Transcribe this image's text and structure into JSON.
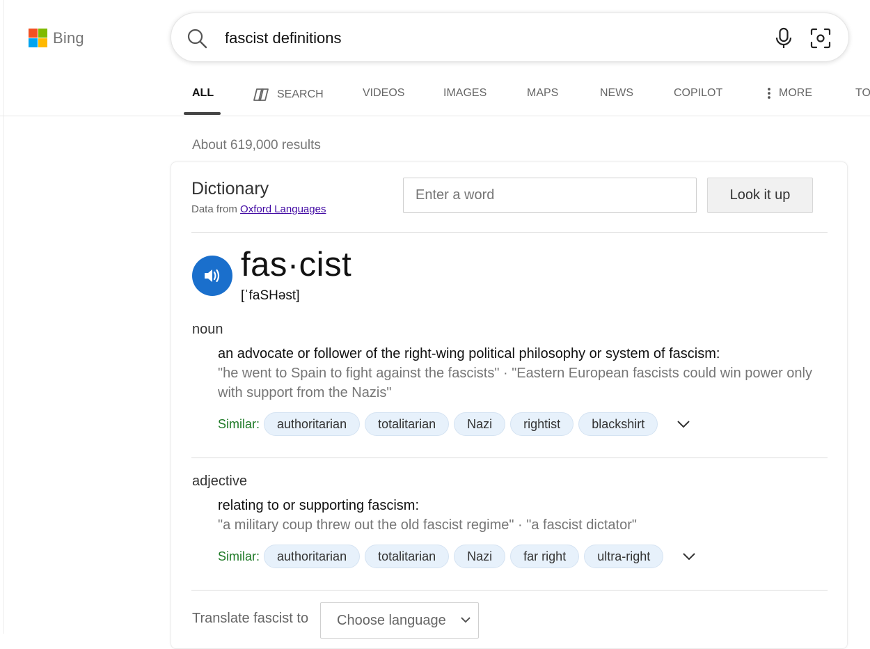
{
  "header": {
    "brand": "Bing",
    "brand_colors": [
      "#f25022",
      "#7fba00",
      "#00a4ef",
      "#ffb900"
    ],
    "search_query": "fascist definitions",
    "icons": [
      "search-icon",
      "microphone-icon",
      "visual-search-icon"
    ]
  },
  "tabs": {
    "all": "ALL",
    "search": "SEARCH",
    "videos": "VIDEOS",
    "images": "IMAGES",
    "maps": "MAPS",
    "news": "NEWS",
    "copilot": "COPILOT",
    "more": "MORE",
    "tools": "TO"
  },
  "results": {
    "count": "About 619,000 results"
  },
  "dictionary": {
    "title": "Dictionary",
    "source_prefix": "Data from",
    "source_link": "Oxford Languages",
    "input_placeholder": "Enter a word",
    "lookup_button": "Look it up",
    "headword": "fas·cist",
    "pronunciation": "[ˈfaSHəst]",
    "accent_color": "#1a6fcc",
    "senses": [
      {
        "pos": "noun",
        "definition": "an advocate or follower of the right-wing political philosophy or system of fascism:",
        "example": "\"he went to Spain to fight against the fascists\" · \"Eastern European fascists could win power only with support from the Nazis\"",
        "similar_label": "Similar:",
        "similar": [
          "authoritarian",
          "totalitarian",
          "Nazi",
          "rightist",
          "blackshirt"
        ]
      },
      {
        "pos": "adjective",
        "definition": "relating to or supporting fascism:",
        "example": "\"a military coup threw out the old fascist regime\" · \"a fascist dictator\"",
        "similar_label": "Similar:",
        "similar": [
          "authoritarian",
          "totalitarian",
          "Nazi",
          "far right",
          "ultra-right"
        ]
      }
    ],
    "translate_label": "Translate fascist to",
    "language_select": "Choose language"
  }
}
